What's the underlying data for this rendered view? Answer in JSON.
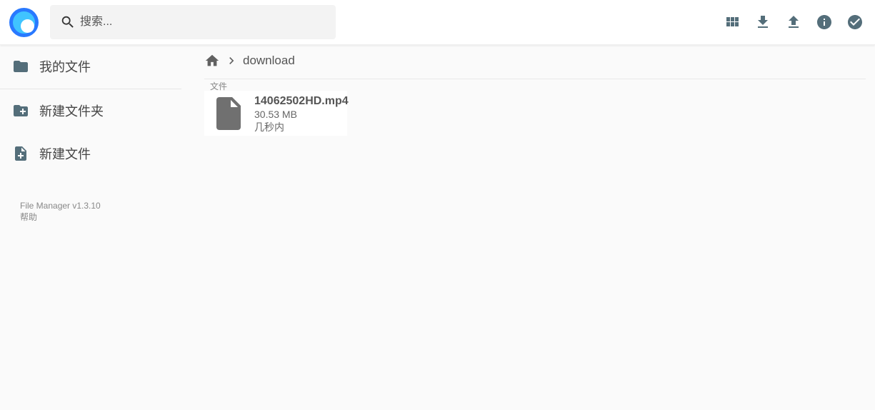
{
  "header": {
    "search_placeholder": "搜索...",
    "actions": [
      {
        "name": "view-toggle",
        "icon": "grid-icon"
      },
      {
        "name": "download",
        "icon": "download-icon"
      },
      {
        "name": "upload",
        "icon": "upload-icon"
      },
      {
        "name": "info",
        "icon": "info-icon"
      },
      {
        "name": "select",
        "icon": "check-circle-icon"
      }
    ]
  },
  "sidebar": {
    "items": [
      {
        "label": "我的文件",
        "icon": "folder-icon"
      },
      {
        "label": "新建文件夹",
        "icon": "new-folder-icon"
      },
      {
        "label": "新建文件",
        "icon": "new-file-icon"
      }
    ],
    "credits": {
      "version": "File Manager v1.3.10",
      "help": "帮助"
    }
  },
  "breadcrumbs": {
    "items": [
      "download"
    ]
  },
  "listing": {
    "section_label": "文件",
    "files": [
      {
        "name": "14062502HD.mp4",
        "size": "30.53 MB",
        "modified": "几秒内"
      }
    ]
  },
  "colors": {
    "accent": "#2979ff",
    "icon": "#546e7a",
    "file_icon": "#707070",
    "background": "#fafafa"
  }
}
